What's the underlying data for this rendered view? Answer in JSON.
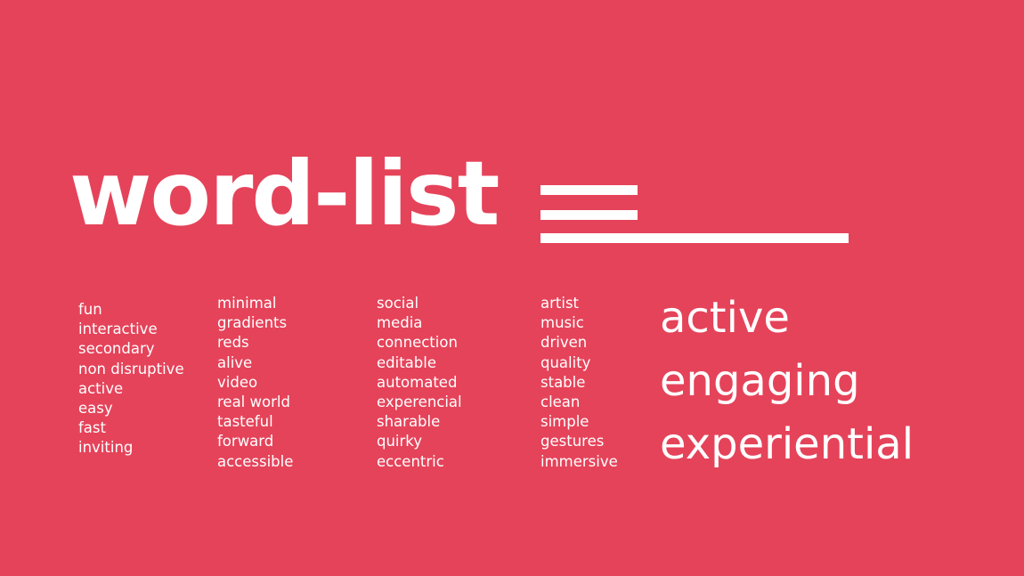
{
  "slide": {
    "title": "word-list",
    "background_color": "#e5435a",
    "text_color": "#ffffff",
    "title_icon": "menu-lines-icon"
  },
  "columns": [
    [
      "fun",
      "interactive",
      "secondary",
      "non disruptive",
      "active",
      "easy",
      "fast",
      "inviting"
    ],
    [
      "minimal",
      "gradients",
      "reds",
      "alive",
      "video",
      "real world",
      "tasteful",
      "forward",
      "accessible"
    ],
    [
      "social",
      "media",
      "connection",
      "editable",
      "automated",
      "experencial",
      "sharable",
      "quirky",
      "eccentric"
    ],
    [
      "artist",
      "music",
      "driven",
      "quality",
      "stable",
      "clean",
      "simple",
      "gestures",
      "immersive"
    ]
  ],
  "highlights": [
    "active",
    "engaging",
    "experiential"
  ]
}
